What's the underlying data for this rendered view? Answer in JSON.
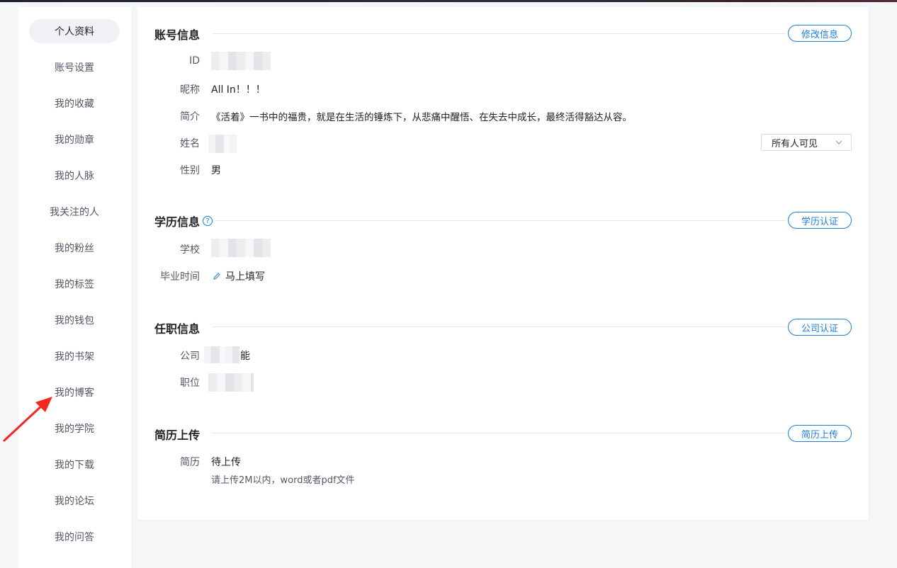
{
  "sidebar": {
    "items": [
      {
        "label": "个人资料",
        "active": true
      },
      {
        "label": "账号设置"
      },
      {
        "label": "我的收藏"
      },
      {
        "label": "我的勋章"
      },
      {
        "label": "我的人脉"
      },
      {
        "label": "我关注的人"
      },
      {
        "label": "我的粉丝"
      },
      {
        "label": "我的标签"
      },
      {
        "label": "我的钱包"
      },
      {
        "label": "我的书架"
      },
      {
        "label": "我的博客"
      },
      {
        "label": "我的学院"
      },
      {
        "label": "我的下载"
      },
      {
        "label": "我的论坛"
      },
      {
        "label": "我的问答"
      }
    ]
  },
  "account": {
    "title": "账号信息",
    "action": "修改信息",
    "id_label": "ID",
    "nickname_label": "昵称",
    "nickname": "All In！！！",
    "intro_label": "简介",
    "intro": "《活着》一书中的福贵，就是在生活的锤炼下，从悲痛中醒悟、在失去中成长，最终活得豁达从容。",
    "name_label": "姓名",
    "visibility": "所有人可见",
    "gender_label": "性别",
    "gender": "男"
  },
  "education": {
    "title": "学历信息",
    "help_glyph": "?",
    "action": "学历认证",
    "school_label": "学校",
    "grad_label": "毕业时间",
    "grad_link": "马上填写"
  },
  "job": {
    "title": "任职信息",
    "action": "公司认证",
    "company_label": "公司",
    "company_suffix": "能",
    "position_label": "职位"
  },
  "resume": {
    "title": "简历上传",
    "action": "简历上传",
    "label": "简历",
    "status": "待上传",
    "hint": "请上传2M以内，word或者pdf文件"
  },
  "colors": {
    "accent": "#1d7dd8",
    "annotation_arrow": "#f5261f"
  }
}
